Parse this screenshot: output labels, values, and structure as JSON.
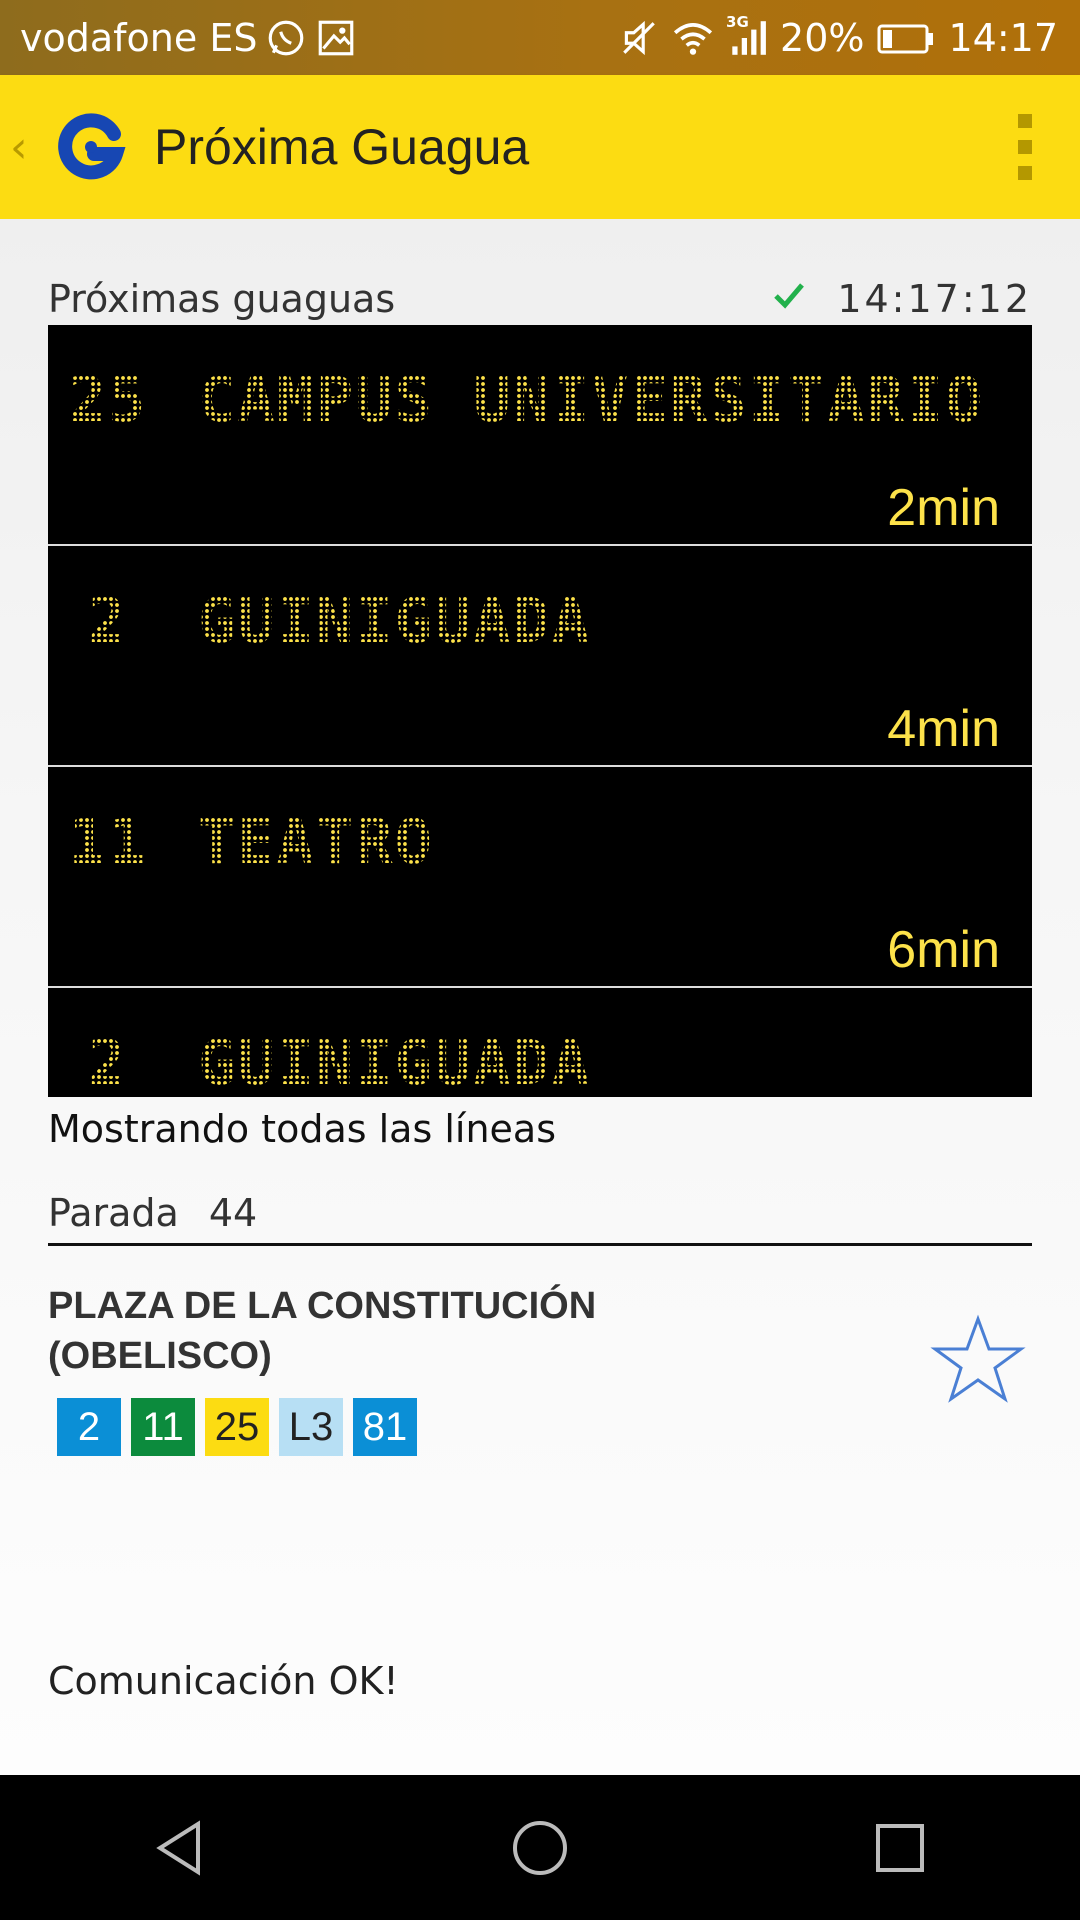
{
  "status_bar": {
    "carrier": "vodafone ES",
    "network": "3G",
    "battery": "20%",
    "time": "14:17"
  },
  "app_bar": {
    "title": "Próxima Guagua",
    "logo_letter": "G"
  },
  "board": {
    "header_label": "Próximas guaguas",
    "update_time": "14:17:12",
    "arrivals": [
      {
        "line": "25",
        "destination": "CAMPUS UNIVERSITARIO",
        "eta": "2min"
      },
      {
        "line": "2",
        "destination": "GUINIGUADA",
        "eta": "4min"
      },
      {
        "line": "11",
        "destination": "TEATRO",
        "eta": "6min"
      },
      {
        "line": "2",
        "destination": "GUINIGUADA",
        "eta": ""
      }
    ]
  },
  "filter_text": "Mostrando todas las líneas",
  "stop": {
    "label": "Parada",
    "number": "44",
    "name": "PLAZA DE LA CONSTITUCIÓN (OBELISCO)",
    "lines": [
      {
        "label": "2",
        "bg": "#0b8fd6",
        "fg": "#ffffff"
      },
      {
        "label": "11",
        "bg": "#0c8b3d",
        "fg": "#ffffff"
      },
      {
        "label": "25",
        "bg": "#fcdc12",
        "fg": "#222222"
      },
      {
        "label": "L3",
        "bg": "#b7dff4",
        "fg": "#222222"
      },
      {
        "label": "81",
        "bg": "#0b8fd6",
        "fg": "#ffffff"
      }
    ]
  },
  "connection_status": "Comunicación OK!",
  "colors": {
    "appbar": "#fcdc12",
    "board_text": "#fde24a",
    "check": "#22b14c",
    "star": "#4a7fd4"
  },
  "icons": [
    "whatsapp-icon",
    "image-icon",
    "mute-icon",
    "wifi-icon",
    "signal-icon",
    "battery-icon",
    "back-chevron-icon",
    "app-logo-icon",
    "overflow-menu-icon",
    "check-icon",
    "star-icon",
    "nav-back-icon",
    "nav-home-icon",
    "nav-recents-icon"
  ]
}
